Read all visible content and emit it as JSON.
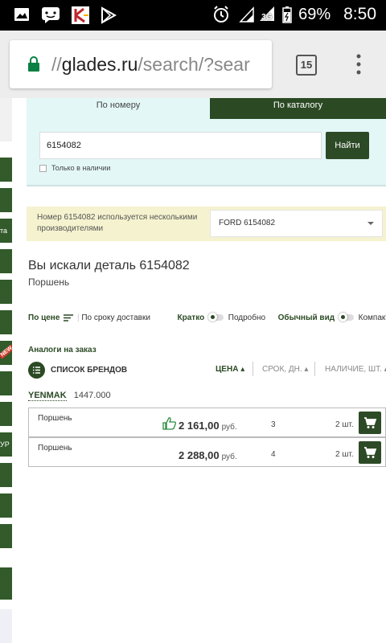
{
  "statusbar": {
    "battery": "69%",
    "time": "8:50",
    "network": "3G"
  },
  "browser": {
    "url_prefix": "//",
    "url_domain": "glades.ru",
    "url_path": "/search/?sear",
    "tab_count": "15"
  },
  "sidebar": {
    "partial_labels": [
      "та",
      "NEW",
      "УР"
    ]
  },
  "search": {
    "tab_by_number": "По номеру",
    "tab_by_catalog": "По каталогу",
    "query": "6154082",
    "find_button": "Найти",
    "in_stock_label": "Только в наличии"
  },
  "notice": {
    "text": "Номер 6154082 используется несколькими производителями",
    "manufacturer_selected": "FORD 6154082"
  },
  "result": {
    "heading": "Вы искали деталь 6154082",
    "part_name": "Поршень"
  },
  "sort": {
    "by_price": "По цене",
    "by_delivery": "По сроку доставки",
    "brief": "Кратко",
    "detailed": "Подробно",
    "normal_view": "Обычный вид",
    "compact": "Компактный"
  },
  "table": {
    "section_title": "Аналоги на заказ",
    "brands_list": "СПИСОК БРЕНДОВ",
    "col_price": "ЦЕНА",
    "col_days": "СРОК, ДН.",
    "col_stock": "НАЛИЧИЕ, ШТ.",
    "brand": {
      "name": "YENMAK",
      "code": "1447.000"
    },
    "rows": [
      {
        "name": "Поршень",
        "price": "2 161,00",
        "currency": "руб.",
        "days": "3",
        "qty": "2 шт."
      },
      {
        "name": "Поршень",
        "price": "2 288,00",
        "currency": "руб.",
        "days": "4",
        "qty": "2 шт."
      }
    ]
  },
  "colors": {
    "brand_green": "#2b4a24",
    "panel": "#e3f7f7",
    "notice": "#f5f3cf",
    "new_badge": "#d23b2b"
  }
}
